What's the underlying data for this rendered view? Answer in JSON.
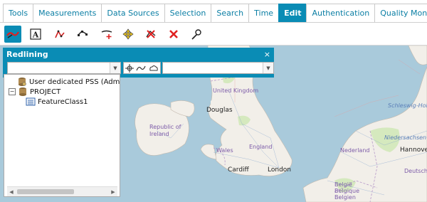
{
  "tabs": [
    "Tools",
    "Measurements",
    "Data Sources",
    "Selection",
    "Search",
    "Time",
    "Edit",
    "Authentication",
    "Quality Monitor"
  ],
  "active_tab": "Edit",
  "toolbar": {
    "tools": [
      "redline-pen-icon",
      "text-annotation-icon",
      "polyline-icon",
      "vertex-edit-icon",
      "split-line-icon",
      "move-feature-icon",
      "delete-vertex-icon",
      "delete-feature-icon",
      "snapping-icon"
    ]
  },
  "redlining": {
    "title": "Redlining",
    "close": "×",
    "select_value": "",
    "style_value": ""
  },
  "tree": {
    "items": [
      {
        "label": "User dedicated PSS (Admin"
      },
      {
        "label": "PROJECT",
        "expander": "−"
      },
      {
        "label": "FeatureClass1"
      }
    ]
  },
  "map": {
    "labels": {
      "united_kingdom": "United Kingdom",
      "douglas": "Douglas",
      "republic_of_ireland": "Republic of Ireland",
      "wales": "Wales",
      "england": "England",
      "cardiff": "Cardiff",
      "london": "London",
      "nederland": "Nederland",
      "niedersachsen": "Niedersachsen",
      "hannover": "Hannover",
      "schleswig_holstein": "Schleswig-Holst",
      "belgie": "België\nBelgique\nBelgien",
      "deutschland": "Deutsch"
    },
    "colors": {
      "sea": "#a9cadb",
      "land": "#f2efe9",
      "green": "#cde7b3"
    }
  }
}
